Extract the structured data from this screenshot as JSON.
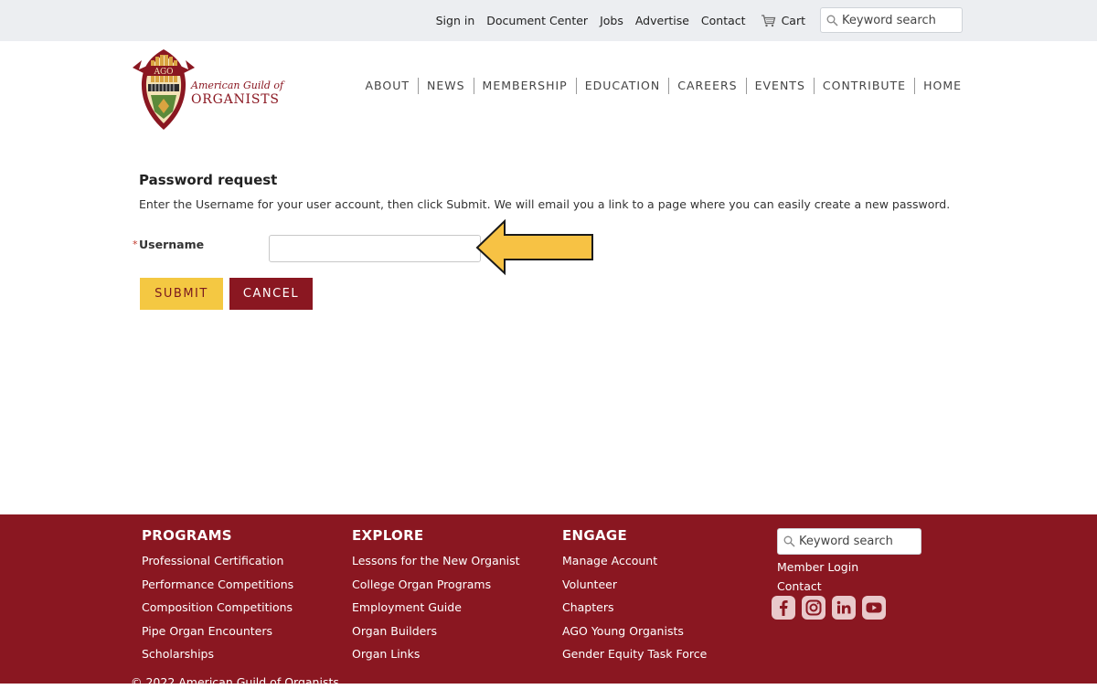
{
  "utility_bar": {
    "links": [
      "Sign in",
      "Document Center",
      "Jobs",
      "Advertise",
      "Contact"
    ],
    "cart_label": "Cart",
    "search_placeholder": "Keyword search"
  },
  "logo": {
    "badge_text": "AGO",
    "line1": "American Guild of",
    "line2": "ORGANISTS"
  },
  "main_nav": [
    "ABOUT",
    "NEWS",
    "MEMBERSHIP",
    "EDUCATION",
    "CAREERS",
    "EVENTS",
    "CONTRIBUTE",
    "HOME"
  ],
  "form": {
    "title": "Password request",
    "instructions": "Enter the Username for your user account, then click Submit. We will email you a link to a page where you can easily create a new password.",
    "required_marker": "*",
    "username_label": "Username",
    "username_value": "",
    "submit_label": "SUBMIT",
    "cancel_label": "CANCEL"
  },
  "annotation": {
    "arrow_color": "#f7c244"
  },
  "footer": {
    "programs": {
      "heading": "PROGRAMS",
      "links": [
        "Professional Certification",
        "Performance Competitions",
        "Composition Competitions",
        "Pipe Organ Encounters",
        "Scholarships"
      ]
    },
    "explore": {
      "heading": "EXPLORE",
      "links": [
        "Lessons for the New Organist",
        "College Organ Programs",
        "Employment Guide",
        "Organ Builders",
        "Organ Links"
      ]
    },
    "engage": {
      "heading": "ENGAGE",
      "links": [
        "Manage Account",
        "Volunteer",
        "Chapters",
        "AGO Young Organists",
        "Gender Equity Task Force"
      ]
    },
    "search_placeholder": "Keyword search",
    "member_login": "Member Login",
    "contact": "Contact",
    "social_icons": [
      "facebook-icon",
      "instagram-icon",
      "linkedin-icon",
      "youtube-icon"
    ],
    "copyright": "© 2022 American Guild of Organists"
  },
  "colors": {
    "brand_red": "#8a1721",
    "accent_yellow": "#f4c842",
    "utility_bg": "#eceef1"
  }
}
